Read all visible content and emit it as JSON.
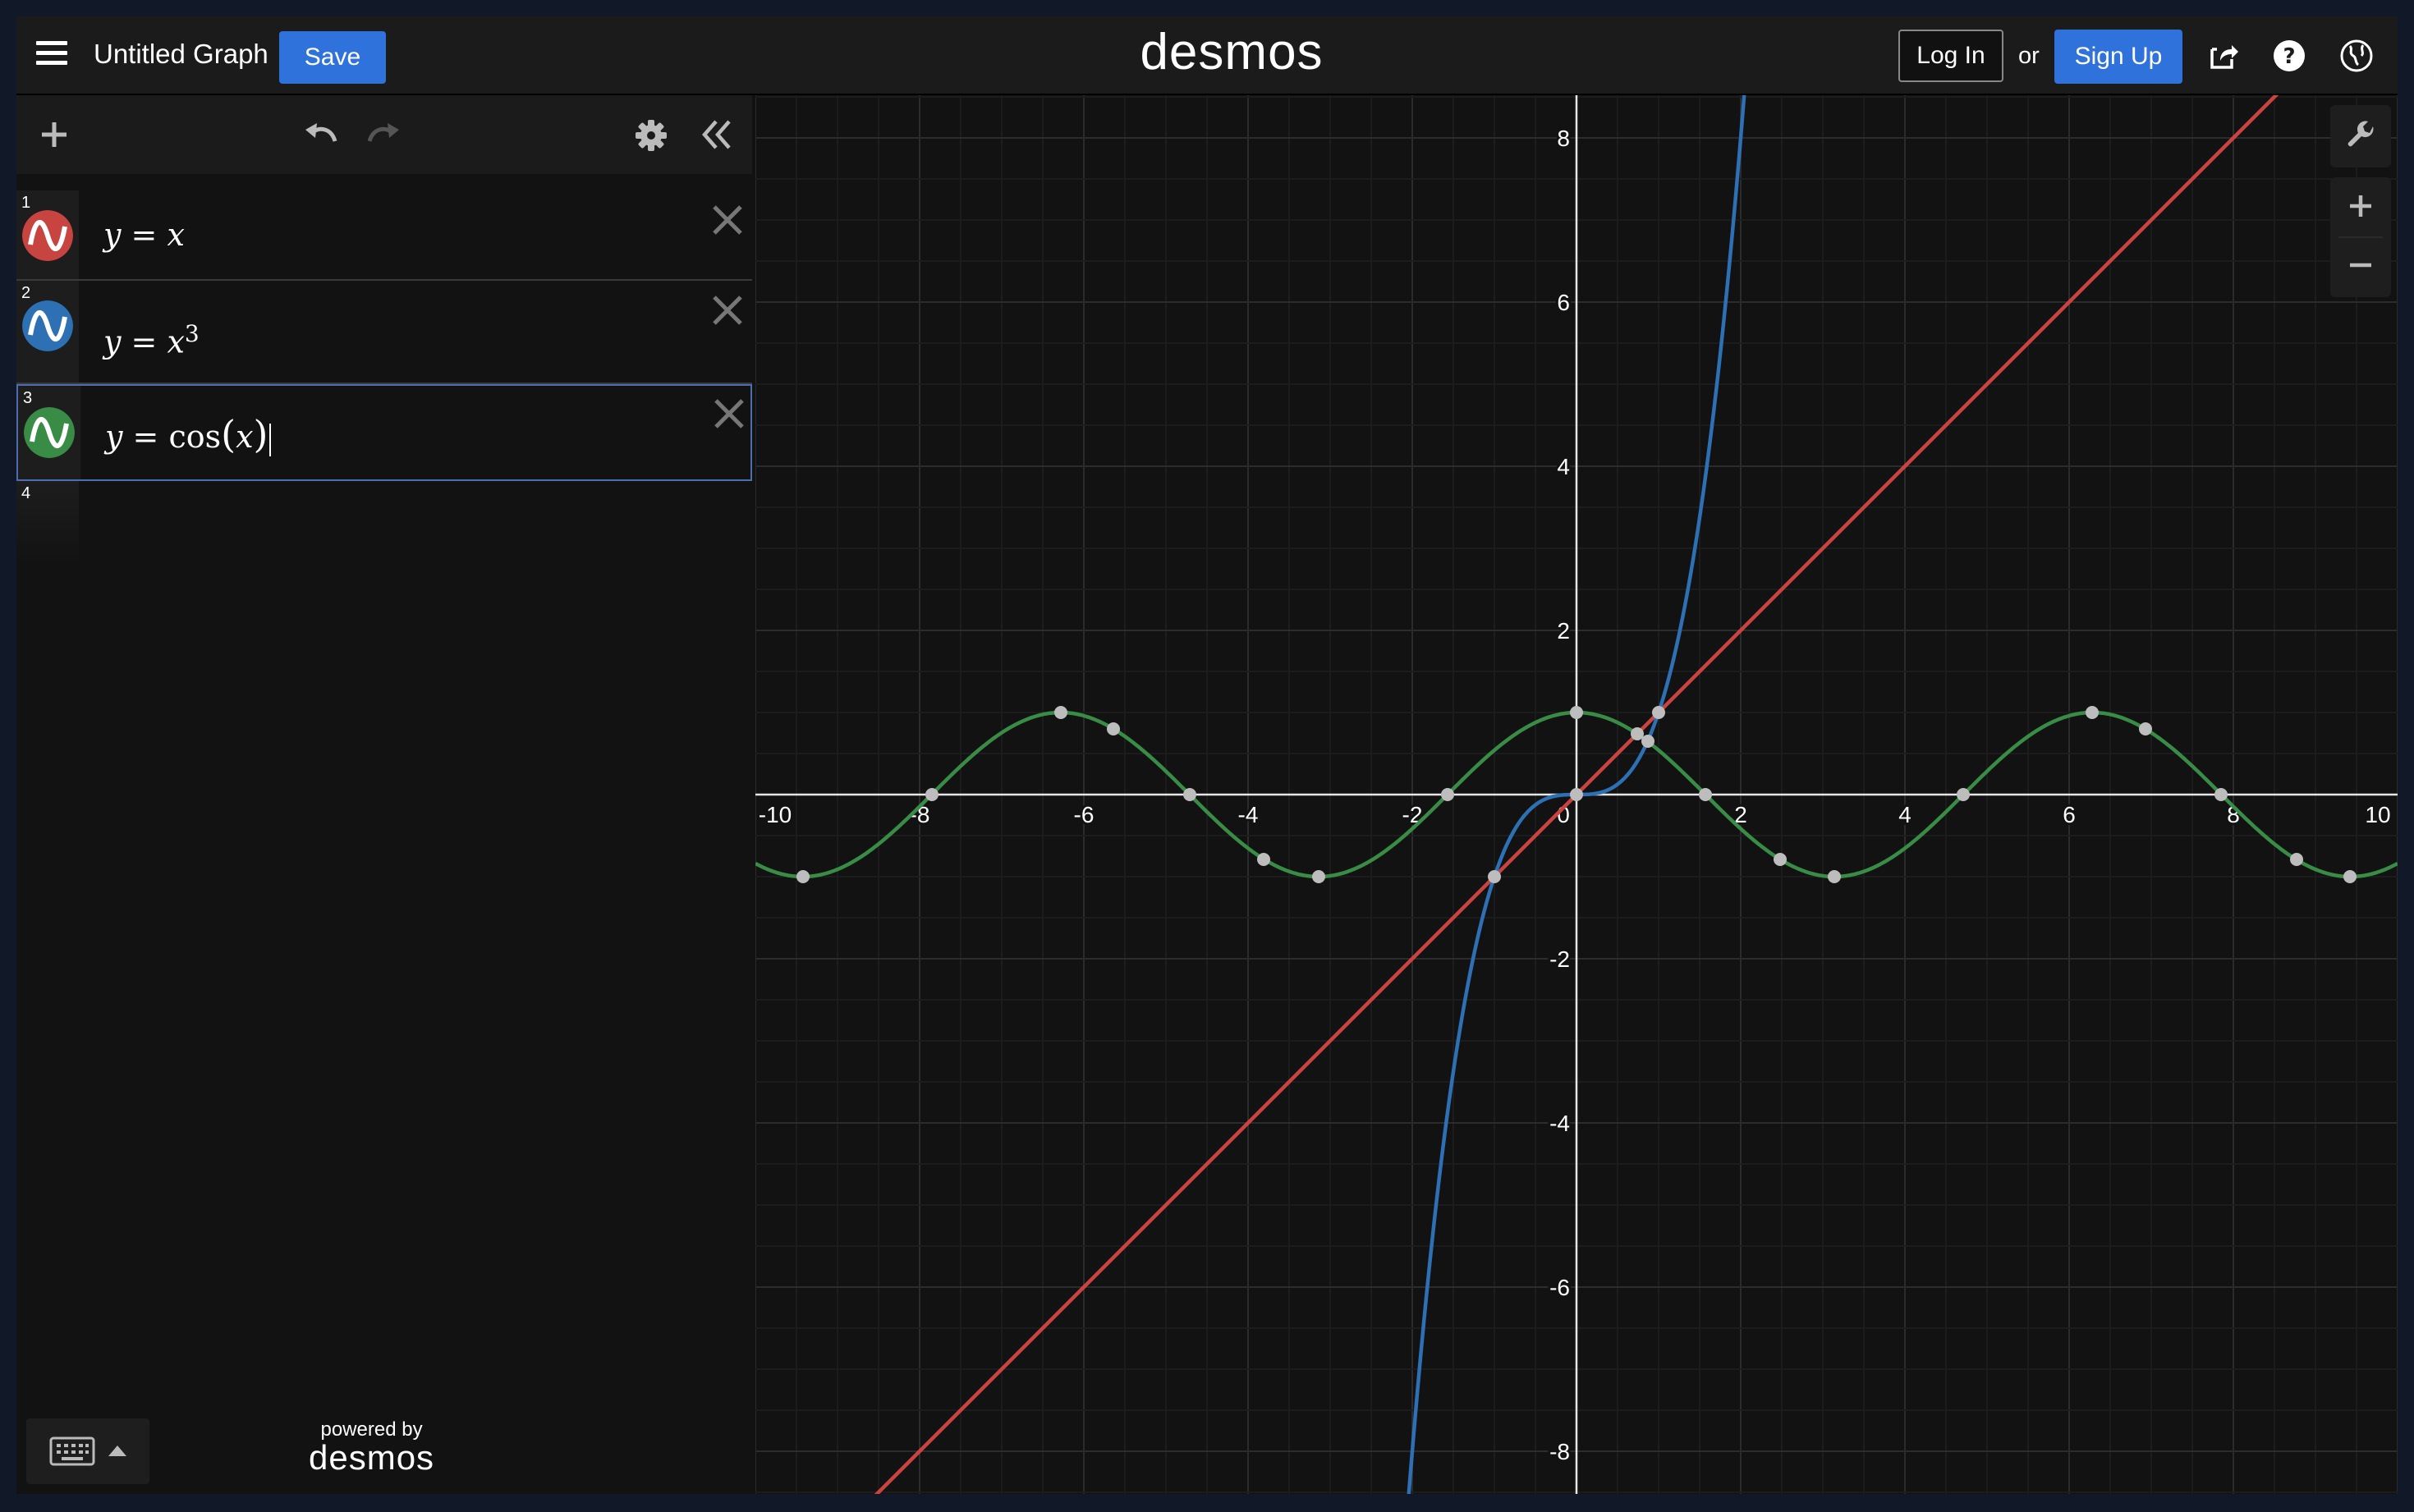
{
  "header": {
    "menu_icon": "hamburger-menu-icon",
    "title": "Untitled Graph",
    "save_label": "Save",
    "logo": "desmos",
    "login_label": "Log In",
    "or_text": "or",
    "signup_label": "Sign Up",
    "icons": [
      "share-icon",
      "help-icon",
      "language-globe-icon"
    ]
  },
  "panel": {
    "toolbar_icons": [
      "add-item-icon",
      "undo-icon",
      "redo-icon",
      "settings-gear-icon",
      "collapse-panel-icon"
    ],
    "expressions": [
      {
        "index": "1",
        "color": "#c74440",
        "parts": [
          "y",
          " = ",
          "x"
        ]
      },
      {
        "index": "2",
        "color": "#2d70b3",
        "parts": [
          "y",
          " = ",
          "x",
          "3"
        ]
      },
      {
        "index": "3",
        "color": "#388c46",
        "parts": [
          "y",
          " = cos",
          "(",
          "x",
          ")"
        ]
      },
      {
        "index": "4"
      }
    ],
    "powered_by": "powered by",
    "powered_logo": "desmos"
  },
  "graph_controls": [
    "wrench-icon",
    "zoom-in-icon",
    "zoom-out-icon"
  ],
  "chart_data": {
    "type": "line",
    "xlim": [
      -10,
      10
    ],
    "ylim": [
      -8.5,
      8.5
    ],
    "x_ticks": [
      "-10",
      "-8",
      "-6",
      "-4",
      "-2",
      "0",
      "2",
      "4",
      "6",
      "8",
      "10"
    ],
    "y_ticks": [
      "8",
      "6",
      "4",
      "2",
      "-2",
      "-4",
      "-6",
      "-8"
    ],
    "grid": true,
    "background": "#121212",
    "series": [
      {
        "expression": "y = x",
        "color": "#c74440",
        "x": [
          -10,
          10
        ],
        "y": [
          -10,
          10
        ]
      },
      {
        "expression": "y = x^3",
        "color": "#2d70b3",
        "x": [
          -2.1,
          -1.5,
          -1,
          -0.5,
          0,
          0.5,
          1,
          1.5,
          2.1
        ],
        "y": [
          -9.26,
          -3.38,
          -1,
          -0.13,
          0,
          0.13,
          1,
          3.38,
          9.26
        ]
      },
      {
        "expression": "y = cos(x)",
        "color": "#388c46",
        "x": [
          -10,
          -6.28,
          -3.14,
          0,
          3.14,
          6.28,
          10
        ],
        "y": [
          -0.84,
          1,
          -1,
          1,
          -1,
          1,
          -0.84
        ]
      }
    ],
    "marked_points": [
      {
        "x": -9.42,
        "y": -1
      },
      {
        "x": -7.85,
        "y": 0
      },
      {
        "x": -6.28,
        "y": 1
      },
      {
        "x": -5.64,
        "y": 0.8
      },
      {
        "x": -4.71,
        "y": 0
      },
      {
        "x": -3.81,
        "y": -0.79
      },
      {
        "x": -3.14,
        "y": -1
      },
      {
        "x": -1.57,
        "y": 0
      },
      {
        "x": 0,
        "y": 1
      },
      {
        "x": 0.74,
        "y": 0.74
      },
      {
        "x": 0.87,
        "y": 0.65
      },
      {
        "x": 1,
        "y": 1
      },
      {
        "x": 1.57,
        "y": 0
      },
      {
        "x": 2.48,
        "y": -0.79
      },
      {
        "x": 3.14,
        "y": -1
      },
      {
        "x": 4.71,
        "y": 0
      },
      {
        "x": 6.28,
        "y": 1
      },
      {
        "x": 6.93,
        "y": 0.8
      },
      {
        "x": 7.85,
        "y": 0
      },
      {
        "x": 8.77,
        "y": -0.79
      },
      {
        "x": 9.42,
        "y": -1
      },
      {
        "x": -1,
        "y": -1
      },
      {
        "x": 0,
        "y": 0
      }
    ]
  }
}
